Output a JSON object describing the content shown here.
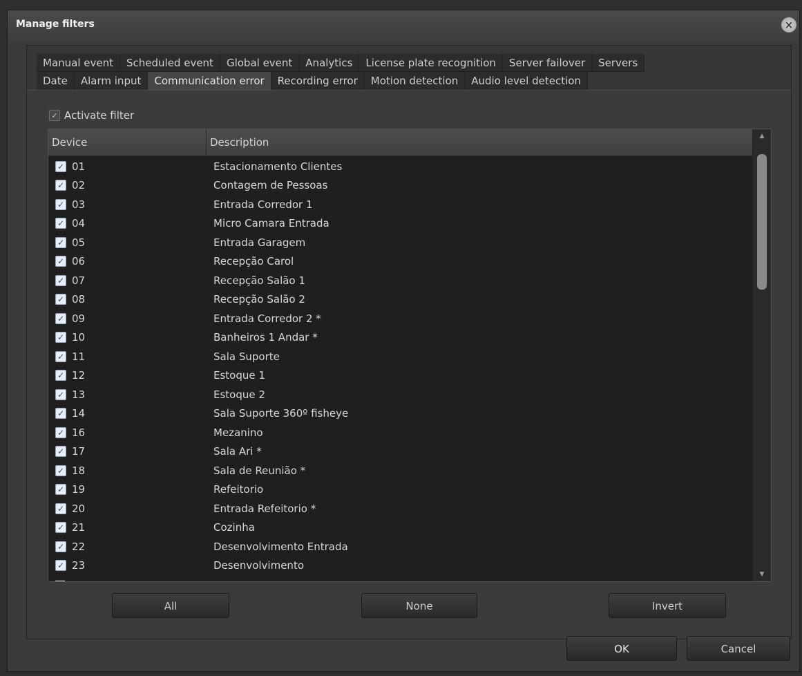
{
  "window": {
    "title": "Manage filters",
    "close_icon": "×"
  },
  "tabs_row1": [
    "Manual event",
    "Scheduled event",
    "Global event",
    "Analytics",
    "License plate recognition",
    "Server failover",
    "Servers"
  ],
  "tabs_row2": [
    "Date",
    "Alarm input",
    "Communication error",
    "Recording error",
    "Motion detection",
    "Audio level detection"
  ],
  "active_tab": "Communication error",
  "activate_filter": {
    "label": "Activate filter",
    "checked": true
  },
  "list": {
    "columns": [
      "Device",
      "Description"
    ],
    "rows": [
      {
        "device": "01",
        "description": "Estacionamento Clientes"
      },
      {
        "device": "02",
        "description": "Contagem de Pessoas"
      },
      {
        "device": "03",
        "description": "Entrada Corredor 1"
      },
      {
        "device": "04",
        "description": "Micro Camara Entrada"
      },
      {
        "device": "05",
        "description": "Entrada Garagem"
      },
      {
        "device": "06",
        "description": "Recepção Carol"
      },
      {
        "device": "07",
        "description": "Recepção Salão 1"
      },
      {
        "device": "08",
        "description": "Recepção Salão 2"
      },
      {
        "device": "09",
        "description": "Entrada Corredor 2 *"
      },
      {
        "device": "10",
        "description": "Banheiros 1 Andar *"
      },
      {
        "device": "11",
        "description": "Sala Suporte"
      },
      {
        "device": "12",
        "description": "Estoque 1"
      },
      {
        "device": "13",
        "description": "Estoque 2"
      },
      {
        "device": "14",
        "description": "Sala Suporte 360º fisheye"
      },
      {
        "device": "16",
        "description": "Mezanino"
      },
      {
        "device": "17",
        "description": "Sala Ari *"
      },
      {
        "device": "18",
        "description": "Sala de Reunião *"
      },
      {
        "device": "19",
        "description": "Refeitorio"
      },
      {
        "device": "20",
        "description": "Entrada Refeitorio *"
      },
      {
        "device": "21",
        "description": "Cozinha"
      },
      {
        "device": "22",
        "description": "Desenvolvimento Entrada"
      },
      {
        "device": "23",
        "description": "Desenvolvimento"
      }
    ]
  },
  "buttons": {
    "all": "All",
    "none": "None",
    "invert": "Invert",
    "ok": "OK",
    "cancel": "Cancel"
  },
  "colors": {
    "background": "#3b3b3b",
    "list_background": "#1f1f1f",
    "checkbox_check": "#2c4f9e"
  }
}
